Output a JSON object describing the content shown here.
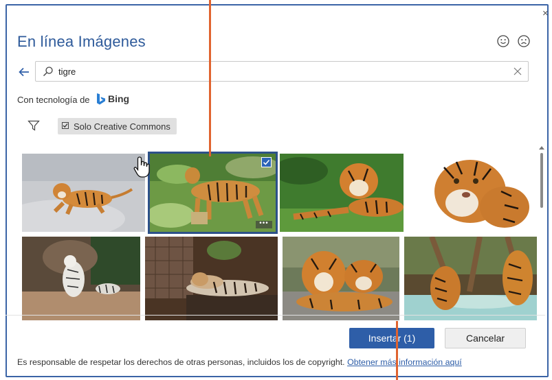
{
  "dialog": {
    "title": "En línea Imágenes",
    "close_glyph": "×",
    "feedback": {
      "positive_icon": "smile-icon",
      "negative_icon": "frown-icon"
    }
  },
  "search": {
    "value": "tigre",
    "placeholder": "",
    "back_icon": "back-arrow-icon",
    "search_icon": "search-icon",
    "clear_icon": "clear-icon"
  },
  "powered_by": {
    "prefix": "Con tecnología de",
    "brand": "Bing"
  },
  "filters": {
    "filter_icon": "filter-icon",
    "creative_commons_label": "Solo Creative Commons",
    "creative_commons_checked": true
  },
  "results": {
    "query": "tigre",
    "selected_index": 1,
    "items": [
      {
        "subject": "tiger lying on snow"
      },
      {
        "subject": "tiger standing on grass"
      },
      {
        "subject": "tiger lying on grass"
      },
      {
        "subject": "tiger portrait on white"
      },
      {
        "subject": "white tigers on rocks"
      },
      {
        "subject": "tiger lying on log"
      },
      {
        "subject": "two tigers on rock"
      },
      {
        "subject": "tigers near water"
      }
    ]
  },
  "actions": {
    "insert_label": "Insertar (1)",
    "cancel_label": "Cancelar"
  },
  "footer": {
    "disclaimer": "Es responsable de respetar los derechos de otras personas, incluidos los de copyright.",
    "link": "Obtener más información aquí"
  },
  "colors": {
    "accent": "#2e5ea8",
    "title": "#2e5a9a",
    "callout": "#e0632f",
    "selection": "#2d5189"
  }
}
